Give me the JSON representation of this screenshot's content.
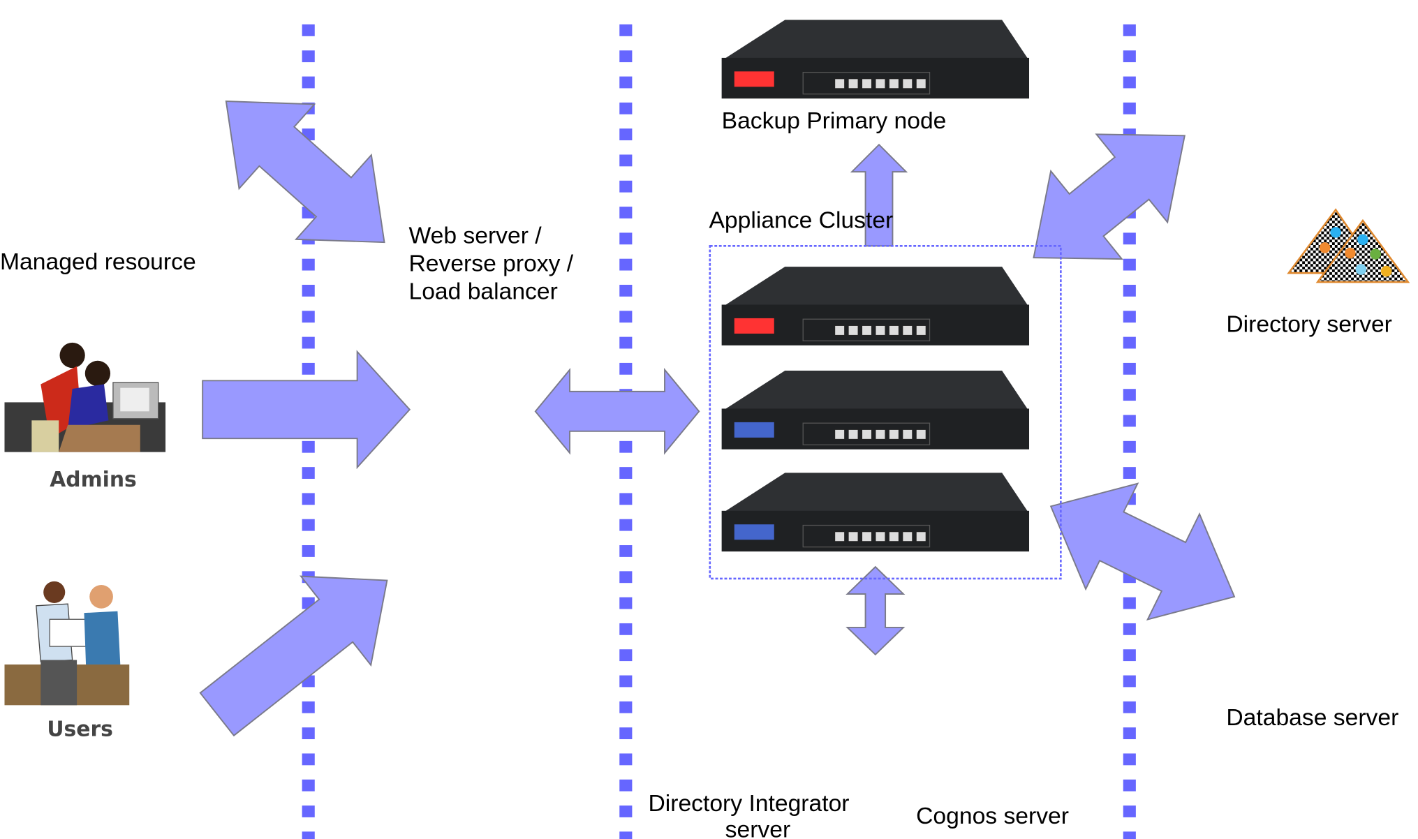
{
  "colors": {
    "boundary": "#6666ff",
    "arrow": "#9999ff",
    "cluster_border": "#6666ff",
    "server_panel_active": "#ff3333",
    "server_panel_idle": "#4466cc"
  },
  "labels": {
    "backup_primary_node": "Backup Primary node",
    "appliance_cluster": "Appliance Cluster",
    "managed_resource": "Managed resource",
    "web_server_line1": "Web server /",
    "web_server_line2": "Reverse proxy /",
    "web_server_line3": "Load balancer",
    "admins": "Admins",
    "users": "Users",
    "directory_server": "Directory server",
    "database_server": "Database server",
    "directory_integrator_line1": "Directory Integrator",
    "directory_integrator_line2": "server",
    "cognos_server": "Cognos server"
  },
  "icons": [
    "admins-people-icon",
    "users-people-icon",
    "appliance-server-icon",
    "directory-tree-icon"
  ]
}
